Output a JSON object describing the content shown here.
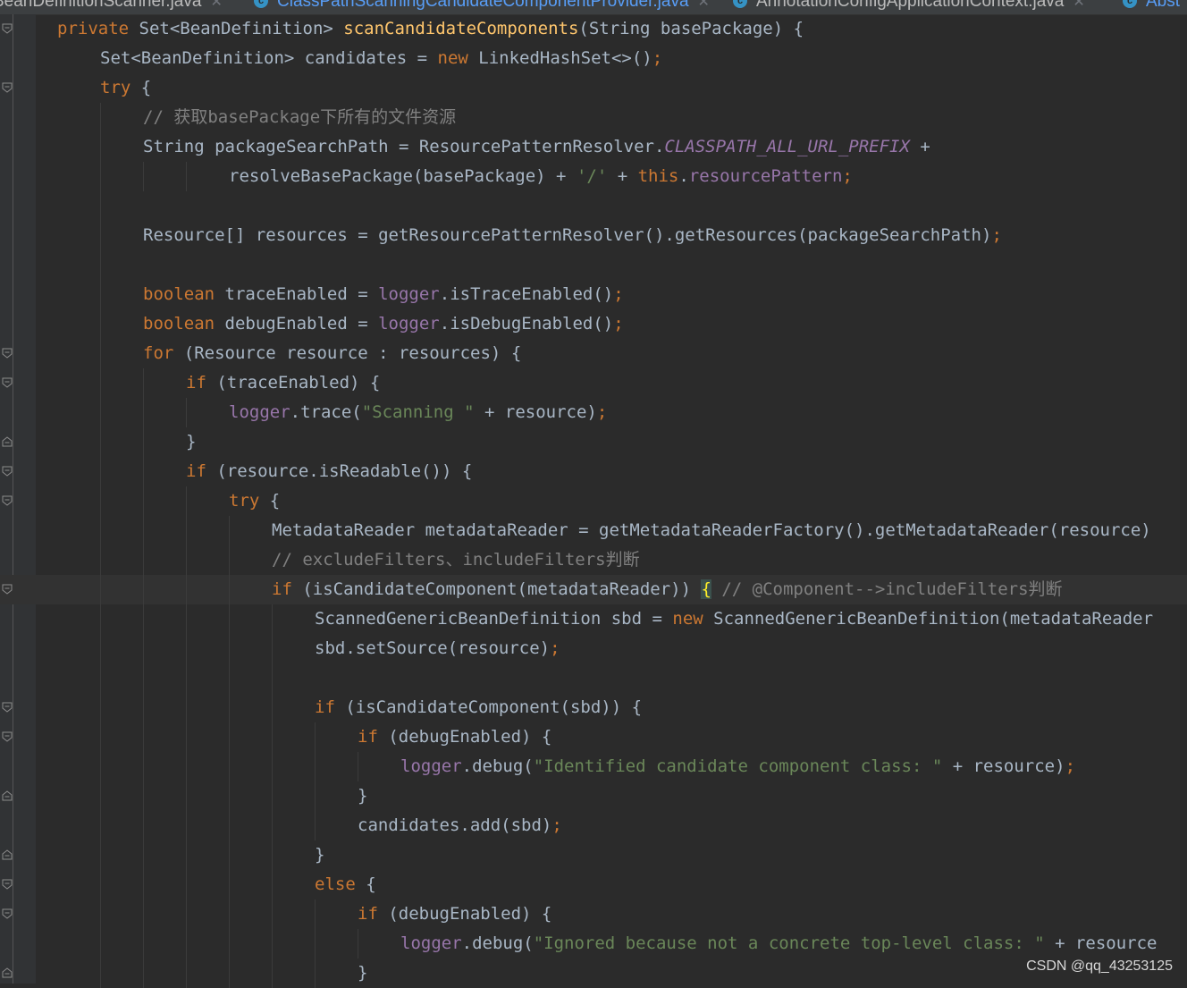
{
  "tabs": [
    {
      "title": "BeanDefinitionScanner.java",
      "active": false
    },
    {
      "title": "ClassPathScanningCandidateComponentProvider.java",
      "active": true
    },
    {
      "title": "AnnotationConfigApplicationContext.java",
      "active": false
    },
    {
      "title": "Abst",
      "active": false
    }
  ],
  "code_lines": [
    {
      "indent": 64,
      "tokens": [
        {
          "t": "private ",
          "c": "kw"
        },
        {
          "t": "Set<BeanDefinition> ",
          "c": "plain"
        },
        {
          "t": "scanCandidateComponents",
          "c": "method"
        },
        {
          "t": "(String basePackage) {",
          "c": "plain"
        }
      ]
    },
    {
      "indent": 112,
      "tokens": [
        {
          "t": "Set<BeanDefinition> candidates = ",
          "c": "plain"
        },
        {
          "t": "new ",
          "c": "kw"
        },
        {
          "t": "LinkedHashSet<>()",
          "c": "plain"
        },
        {
          "t": ";",
          "c": "kw"
        }
      ]
    },
    {
      "indent": 112,
      "tokens": [
        {
          "t": "try ",
          "c": "kw"
        },
        {
          "t": "{",
          "c": "plain"
        }
      ]
    },
    {
      "indent": 160,
      "tokens": [
        {
          "t": "// 获取basePackage下所有的文件资源",
          "c": "comment"
        }
      ]
    },
    {
      "indent": 160,
      "tokens": [
        {
          "t": "String packageSearchPath = ResourcePatternResolver.",
          "c": "plain"
        },
        {
          "t": "CLASSPATH_ALL_URL_PREFIX",
          "c": "const"
        },
        {
          "t": " +",
          "c": "plain"
        }
      ]
    },
    {
      "indent": 256,
      "tokens": [
        {
          "t": "resolveBasePackage(basePackage) + ",
          "c": "plain"
        },
        {
          "t": "'/'",
          "c": "str"
        },
        {
          "t": " + ",
          "c": "plain"
        },
        {
          "t": "this",
          "c": "kw"
        },
        {
          "t": ".",
          "c": "plain"
        },
        {
          "t": "resourcePattern",
          "c": "field"
        },
        {
          "t": ";",
          "c": "kw"
        }
      ]
    },
    {
      "indent": 160,
      "tokens": []
    },
    {
      "indent": 160,
      "tokens": [
        {
          "t": "Resource[] resources = getResourcePatternResolver().getResources(packageSearchPath)",
          "c": "plain"
        },
        {
          "t": ";",
          "c": "kw"
        }
      ]
    },
    {
      "indent": 160,
      "tokens": []
    },
    {
      "indent": 160,
      "tokens": [
        {
          "t": "boolean ",
          "c": "kw"
        },
        {
          "t": "traceEnabled = ",
          "c": "plain"
        },
        {
          "t": "logger",
          "c": "field"
        },
        {
          "t": ".isTraceEnabled()",
          "c": "plain"
        },
        {
          "t": ";",
          "c": "kw"
        }
      ]
    },
    {
      "indent": 160,
      "tokens": [
        {
          "t": "boolean ",
          "c": "kw"
        },
        {
          "t": "debugEnabled = ",
          "c": "plain"
        },
        {
          "t": "logger",
          "c": "field"
        },
        {
          "t": ".isDebugEnabled()",
          "c": "plain"
        },
        {
          "t": ";",
          "c": "kw"
        }
      ]
    },
    {
      "indent": 160,
      "tokens": [
        {
          "t": "for ",
          "c": "kw"
        },
        {
          "t": "(Resource resource : resources) {",
          "c": "plain"
        }
      ]
    },
    {
      "indent": 208,
      "tokens": [
        {
          "t": "if ",
          "c": "kw"
        },
        {
          "t": "(traceEnabled) {",
          "c": "plain"
        }
      ]
    },
    {
      "indent": 256,
      "tokens": [
        {
          "t": "logger",
          "c": "field"
        },
        {
          "t": ".trace(",
          "c": "plain"
        },
        {
          "t": "\"Scanning \"",
          "c": "str"
        },
        {
          "t": " + resource)",
          "c": "plain"
        },
        {
          "t": ";",
          "c": "kw"
        }
      ]
    },
    {
      "indent": 208,
      "tokens": [
        {
          "t": "}",
          "c": "plain"
        }
      ]
    },
    {
      "indent": 208,
      "tokens": [
        {
          "t": "if ",
          "c": "kw"
        },
        {
          "t": "(resource.isReadable()) {",
          "c": "plain"
        }
      ]
    },
    {
      "indent": 256,
      "tokens": [
        {
          "t": "try ",
          "c": "kw"
        },
        {
          "t": "{",
          "c": "plain"
        }
      ]
    },
    {
      "indent": 304,
      "tokens": [
        {
          "t": "MetadataReader metadataReader = getMetadataReaderFactory().getMetadataReader(resource)",
          "c": "plain"
        }
      ]
    },
    {
      "indent": 304,
      "tokens": [
        {
          "t": "// excludeFilters、includeFilters判断",
          "c": "comment"
        }
      ]
    },
    {
      "indent": 304,
      "current": true,
      "tokens": [
        {
          "t": "if ",
          "c": "kw"
        },
        {
          "t": "(isCandidateComponent(metadataReader)) ",
          "c": "plain"
        },
        {
          "t": "{",
          "c": "brace-hl"
        },
        {
          "t": " // @Component-->includeFilters判断",
          "c": "comment"
        }
      ]
    },
    {
      "indent": 352,
      "tokens": [
        {
          "t": "ScannedGenericBeanDefinition sbd = ",
          "c": "plain"
        },
        {
          "t": "new ",
          "c": "kw"
        },
        {
          "t": "ScannedGenericBeanDefinition(metadataReader",
          "c": "plain"
        }
      ]
    },
    {
      "indent": 352,
      "tokens": [
        {
          "t": "sbd.setSource(resource)",
          "c": "plain"
        },
        {
          "t": ";",
          "c": "kw"
        }
      ]
    },
    {
      "indent": 352,
      "tokens": []
    },
    {
      "indent": 352,
      "tokens": [
        {
          "t": "if ",
          "c": "kw"
        },
        {
          "t": "(isCandidateComponent(sbd)) {",
          "c": "plain"
        }
      ]
    },
    {
      "indent": 400,
      "tokens": [
        {
          "t": "if ",
          "c": "kw"
        },
        {
          "t": "(debugEnabled) {",
          "c": "plain"
        }
      ]
    },
    {
      "indent": 448,
      "tokens": [
        {
          "t": "logger",
          "c": "field"
        },
        {
          "t": ".debug(",
          "c": "plain"
        },
        {
          "t": "\"Identified candidate component class: \"",
          "c": "str"
        },
        {
          "t": " + resource)",
          "c": "plain"
        },
        {
          "t": ";",
          "c": "kw"
        }
      ]
    },
    {
      "indent": 400,
      "tokens": [
        {
          "t": "}",
          "c": "plain"
        }
      ]
    },
    {
      "indent": 400,
      "tokens": [
        {
          "t": "candidates.add(sbd)",
          "c": "plain"
        },
        {
          "t": ";",
          "c": "kw"
        }
      ]
    },
    {
      "indent": 352,
      "tokens": [
        {
          "t": "}",
          "c": "plain"
        }
      ]
    },
    {
      "indent": 352,
      "tokens": [
        {
          "t": "else ",
          "c": "kw"
        },
        {
          "t": "{",
          "c": "plain"
        }
      ]
    },
    {
      "indent": 400,
      "tokens": [
        {
          "t": "if ",
          "c": "kw"
        },
        {
          "t": "(debugEnabled) {",
          "c": "plain"
        }
      ]
    },
    {
      "indent": 448,
      "tokens": [
        {
          "t": "logger",
          "c": "field"
        },
        {
          "t": ".debug(",
          "c": "plain"
        },
        {
          "t": "\"Ignored because not a concrete top-level class: \"",
          "c": "str"
        },
        {
          "t": " + resource",
          "c": "plain"
        }
      ]
    },
    {
      "indent": 400,
      "tokens": [
        {
          "t": "}",
          "c": "plain"
        }
      ]
    }
  ],
  "fold_markers": [
    {
      "line": 0,
      "kind": "open"
    },
    {
      "line": 2,
      "kind": "open"
    },
    {
      "line": 11,
      "kind": "open"
    },
    {
      "line": 12,
      "kind": "open"
    },
    {
      "line": 14,
      "kind": "close"
    },
    {
      "line": 15,
      "kind": "open"
    },
    {
      "line": 16,
      "kind": "open"
    },
    {
      "line": 19,
      "kind": "open"
    },
    {
      "line": 23,
      "kind": "open"
    },
    {
      "line": 24,
      "kind": "open"
    },
    {
      "line": 26,
      "kind": "close"
    },
    {
      "line": 28,
      "kind": "close"
    },
    {
      "line": 29,
      "kind": "open"
    },
    {
      "line": 30,
      "kind": "open"
    },
    {
      "line": 32,
      "kind": "close"
    }
  ],
  "watermark": "CSDN @qq_43253125",
  "colors": {
    "background": "#2b2b2b",
    "keyword": "#cc7832",
    "method_decl": "#ffc66d",
    "field": "#9876aa",
    "string": "#6a8759",
    "comment": "#808080",
    "plain": "#a9b7c6"
  }
}
